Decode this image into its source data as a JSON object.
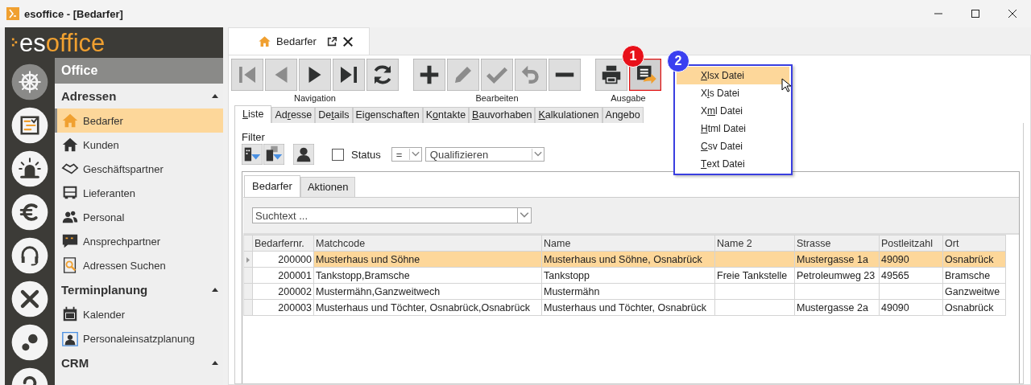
{
  "window": {
    "title": "esoffice - [Bedarfer]"
  },
  "logo": {
    "prefix": "es",
    "suffix": "office"
  },
  "rail": [
    {
      "selected": true
    },
    {
      "selected": false
    },
    {
      "selected": false
    },
    {
      "selected": false
    },
    {
      "selected": false
    },
    {
      "selected": false
    },
    {
      "selected": false
    },
    {
      "selected": false
    }
  ],
  "nav": {
    "title": "Office",
    "groups": [
      {
        "label": "Adressen",
        "expanded": true,
        "items": [
          {
            "label": "Bedarfer",
            "selected": true
          },
          {
            "label": "Kunden",
            "selected": false
          },
          {
            "label": "Geschäftspartner",
            "selected": false
          },
          {
            "label": "Lieferanten",
            "selected": false
          },
          {
            "label": "Personal",
            "selected": false
          },
          {
            "label": "Ansprechpartner",
            "selected": false
          },
          {
            "label": "Adressen Suchen",
            "selected": false
          }
        ]
      },
      {
        "label": "Terminplanung",
        "expanded": true,
        "items": [
          {
            "label": "Kalender",
            "selected": false
          },
          {
            "label": "Personaleinsatzplanung",
            "selected": false
          }
        ]
      },
      {
        "label": "CRM",
        "expanded": true
      }
    ]
  },
  "document_tab": {
    "label": "Bedarfer"
  },
  "toolbar": {
    "groups": [
      {
        "label": "Navigation",
        "buttons": [
          {
            "disabled": true
          },
          {
            "disabled": true
          },
          {
            "disabled": false
          },
          {
            "disabled": false
          },
          {
            "disabled": false
          }
        ]
      },
      {
        "label": "Bearbeiten",
        "buttons": [
          {
            "disabled": false
          },
          {
            "disabled": true
          },
          {
            "disabled": true
          },
          {
            "disabled": true
          },
          {
            "disabled": false
          }
        ]
      },
      {
        "label": "Ausgabe",
        "buttons": [
          {
            "disabled": false,
            "highlighted": false
          },
          {
            "disabled": false,
            "highlighted": true
          }
        ]
      }
    ]
  },
  "callouts": [
    {
      "label": "1",
      "color": "#e8101a"
    },
    {
      "label": "2",
      "color": "#3a3ff0"
    }
  ],
  "export_menu": {
    "items": [
      {
        "label": [
          {
            "text": "X",
            "underline": true
          },
          {
            "text": "lsx Datei",
            "underline": false
          }
        ],
        "selected": true
      },
      {
        "label": [
          {
            "text": "X",
            "underline": false
          },
          {
            "text": "l",
            "underline": true
          },
          {
            "text": "s Datei",
            "underline": false
          }
        ],
        "selected": false
      },
      {
        "label": [
          {
            "text": "X",
            "underline": false
          },
          {
            "text": "m",
            "underline": true
          },
          {
            "text": "l Datei",
            "underline": false
          }
        ],
        "selected": false
      },
      {
        "label": [
          {
            "text": "H",
            "underline": true
          },
          {
            "text": "tml Datei",
            "underline": false
          }
        ],
        "selected": false
      },
      {
        "label": [
          {
            "text": "C",
            "underline": true
          },
          {
            "text": "sv Datei",
            "underline": false
          }
        ],
        "selected": false
      },
      {
        "label": [
          {
            "text": "T",
            "underline": true
          },
          {
            "text": "ext Datei",
            "underline": false
          }
        ],
        "selected": false
      }
    ]
  },
  "tabs": [
    {
      "label": [
        {
          "text": "L",
          "underline": true
        },
        {
          "text": "iste",
          "underline": false
        }
      ],
      "selected": true
    },
    {
      "label": [
        {
          "text": "Ad",
          "underline": false
        },
        {
          "text": "r",
          "underline": true
        },
        {
          "text": "esse",
          "underline": false
        }
      ],
      "selected": false
    },
    {
      "label": [
        {
          "text": "De",
          "underline": false
        },
        {
          "text": "t",
          "underline": true
        },
        {
          "text": "ails",
          "underline": false
        }
      ],
      "selected": false
    },
    {
      "label": [
        {
          "text": "Eigenschaften",
          "underline": false
        }
      ],
      "selected": false
    },
    {
      "label": [
        {
          "text": "K",
          "underline": false
        },
        {
          "text": "o",
          "underline": true
        },
        {
          "text": "ntakte",
          "underline": false
        }
      ],
      "selected": false
    },
    {
      "label": [
        {
          "text": "B",
          "underline": true
        },
        {
          "text": "auvorhaben",
          "underline": false
        }
      ],
      "selected": false
    },
    {
      "label": [
        {
          "text": "K",
          "underline": true
        },
        {
          "text": "alkulationen",
          "underline": false
        }
      ],
      "selected": false
    },
    {
      "label": [
        {
          "text": "Angebo",
          "underline": false
        }
      ],
      "selected": false
    }
  ],
  "filter": {
    "label": "Filter",
    "status": {
      "label": "Status",
      "checked": false
    },
    "operator": "=",
    "value": "Qualifizieren"
  },
  "subtabs": [
    {
      "label": "Bedarfer",
      "selected": true
    },
    {
      "label": "Aktionen",
      "selected": false
    }
  ],
  "search": {
    "placeholder": "Suchtext ..."
  },
  "table": {
    "columns": [
      "Bedarfernr.",
      "Matchcode",
      "Name",
      "Name 2",
      "Strasse",
      "Postleitzahl",
      "Ort"
    ],
    "rows": [
      {
        "cells": [
          "200000",
          "Musterhaus und Söhne",
          "Musterhaus und Söhne, Osnabrück",
          "",
          "Mustergasse 1a",
          "49090",
          "Osnabrück"
        ],
        "selected": true
      },
      {
        "cells": [
          "200001",
          "Tankstopp,Bramsche",
          "Tankstopp",
          "Freie Tankstelle",
          "Petroleumweg 23",
          "49565",
          "Bramsche"
        ],
        "selected": false
      },
      {
        "cells": [
          "200002",
          "Mustermähn,Ganzweitwech",
          "Mustermähn",
          "",
          "",
          "",
          "Ganzweitwe"
        ],
        "selected": false
      },
      {
        "cells": [
          "200003",
          "Musterhaus und Töchter, Osnabrück,Osnabrück",
          "Musterhaus und Töchter, Osnabrück",
          "",
          "Mustergasse 2a",
          "49090",
          "Osnabrück"
        ],
        "selected": false
      }
    ]
  }
}
